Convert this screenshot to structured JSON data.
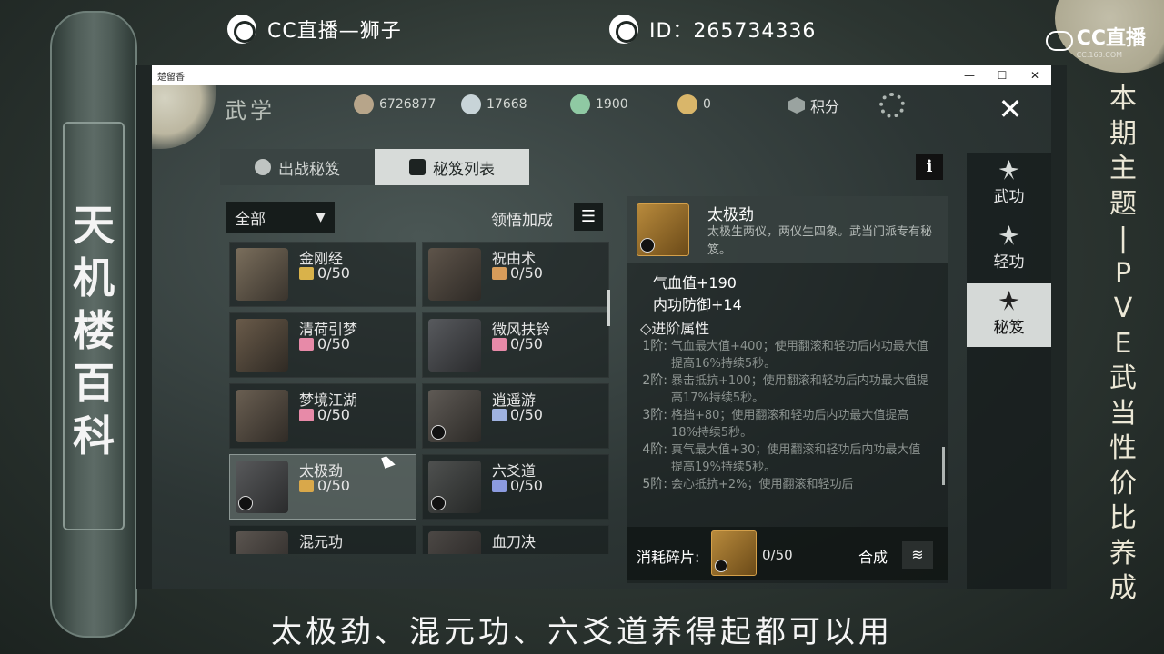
{
  "stream": {
    "channel": "CC直播—狮子",
    "id_label": "ID：265734336",
    "brand": "CC直播",
    "brand_sub": "CC.163.COM"
  },
  "left_scroll": {
    "text": [
      "天",
      "机",
      "楼",
      "百",
      "科"
    ]
  },
  "right_scroll": {
    "text": [
      "本",
      "期",
      "主",
      "题",
      "|",
      "P",
      "V",
      "E",
      "武",
      "当",
      "性",
      "价",
      "比",
      "养",
      "成"
    ]
  },
  "window": {
    "title": "楚留香",
    "controls": [
      "—",
      "☐",
      "✕"
    ]
  },
  "header": {
    "title": "武学",
    "currencies": [
      {
        "value": "6726877",
        "color": "#b7a58a"
      },
      {
        "value": "17668",
        "color": "#c8d4d8"
      },
      {
        "value": "1900",
        "color": "#8fc9a3"
      },
      {
        "value": "0",
        "color": "#d9b66a"
      }
    ],
    "score_label": "积分"
  },
  "tabs": [
    {
      "label": "出战秘笈",
      "active": false
    },
    {
      "label": "秘笈列表",
      "active": true
    }
  ],
  "filter": {
    "selected": "全部"
  },
  "comprehension_label": "领悟加成",
  "books": [
    {
      "name": "金刚经",
      "count": "0/50",
      "frag_color": "#d9b24a",
      "thumb": "#7a6e5c"
    },
    {
      "name": "祝由术",
      "count": "0/50",
      "frag_color": "#d79c5a",
      "thumb": "#5e544a"
    },
    {
      "name": "清荷引梦",
      "count": "0/50",
      "frag_color": "#e78aa8",
      "thumb": "#6a5b4a"
    },
    {
      "name": "微风扶铃",
      "count": "0/50",
      "frag_color": "#e78aa8",
      "thumb": "#585a5e"
    },
    {
      "name": "梦境江湖",
      "count": "0/50",
      "frag_color": "#e78aa8",
      "thumb": "#6a5f52"
    },
    {
      "name": "逍遥游",
      "count": "0/50",
      "frag_color": "#9fb2e0",
      "thumb": "#5f5a55"
    },
    {
      "name": "太极劲",
      "count": "0/50",
      "frag_color": "#d9a84a",
      "thumb": "#58595b",
      "selected": true
    },
    {
      "name": "六爻道",
      "count": "0/50",
      "frag_color": "#8c9be0",
      "thumb": "#4f5150"
    },
    {
      "name": "混元功",
      "count": "",
      "frag_color": "#8fa0e0",
      "thumb": "#5b5550"
    },
    {
      "name": "血刀决",
      "count": "",
      "frag_color": "#d99a5a",
      "thumb": "#4c4845"
    }
  ],
  "detail": {
    "name": "太极劲",
    "description": "太极生两仪，两仪生四象。武当门派专有秘笈。",
    "stats": [
      "气血值+190",
      "内功防御+14"
    ],
    "advanced_title": "◇进阶属性",
    "tiers": [
      {
        "level": "1阶:",
        "text": "气血最大值+400；使用翻滚和轻功后内功最大值提高16%持续5秒。"
      },
      {
        "level": "2阶:",
        "text": "暴击抵抗+100；使用翻滚和轻功后内功最大值提高17%持续5秒。"
      },
      {
        "level": "3阶:",
        "text": "格挡+80；使用翻滚和轻功后内功最大值提高18%持续5秒。"
      },
      {
        "level": "4阶:",
        "text": "真气最大值+30；使用翻滚和轻功后内功最大值提高19%持续5秒。"
      },
      {
        "level": "5阶:",
        "text": "会心抵抗+2%；使用翻滚和轻功后"
      }
    ],
    "cost_label": "消耗碎片:",
    "cost_count": "0/50",
    "synth_label": "合成"
  },
  "side_nav": [
    {
      "label": "武功",
      "active": false
    },
    {
      "label": "轻功",
      "active": false
    },
    {
      "label": "秘笈",
      "active": true
    }
  ],
  "subtitle": "太极劲、混元功、六爻道养得起都可以用"
}
